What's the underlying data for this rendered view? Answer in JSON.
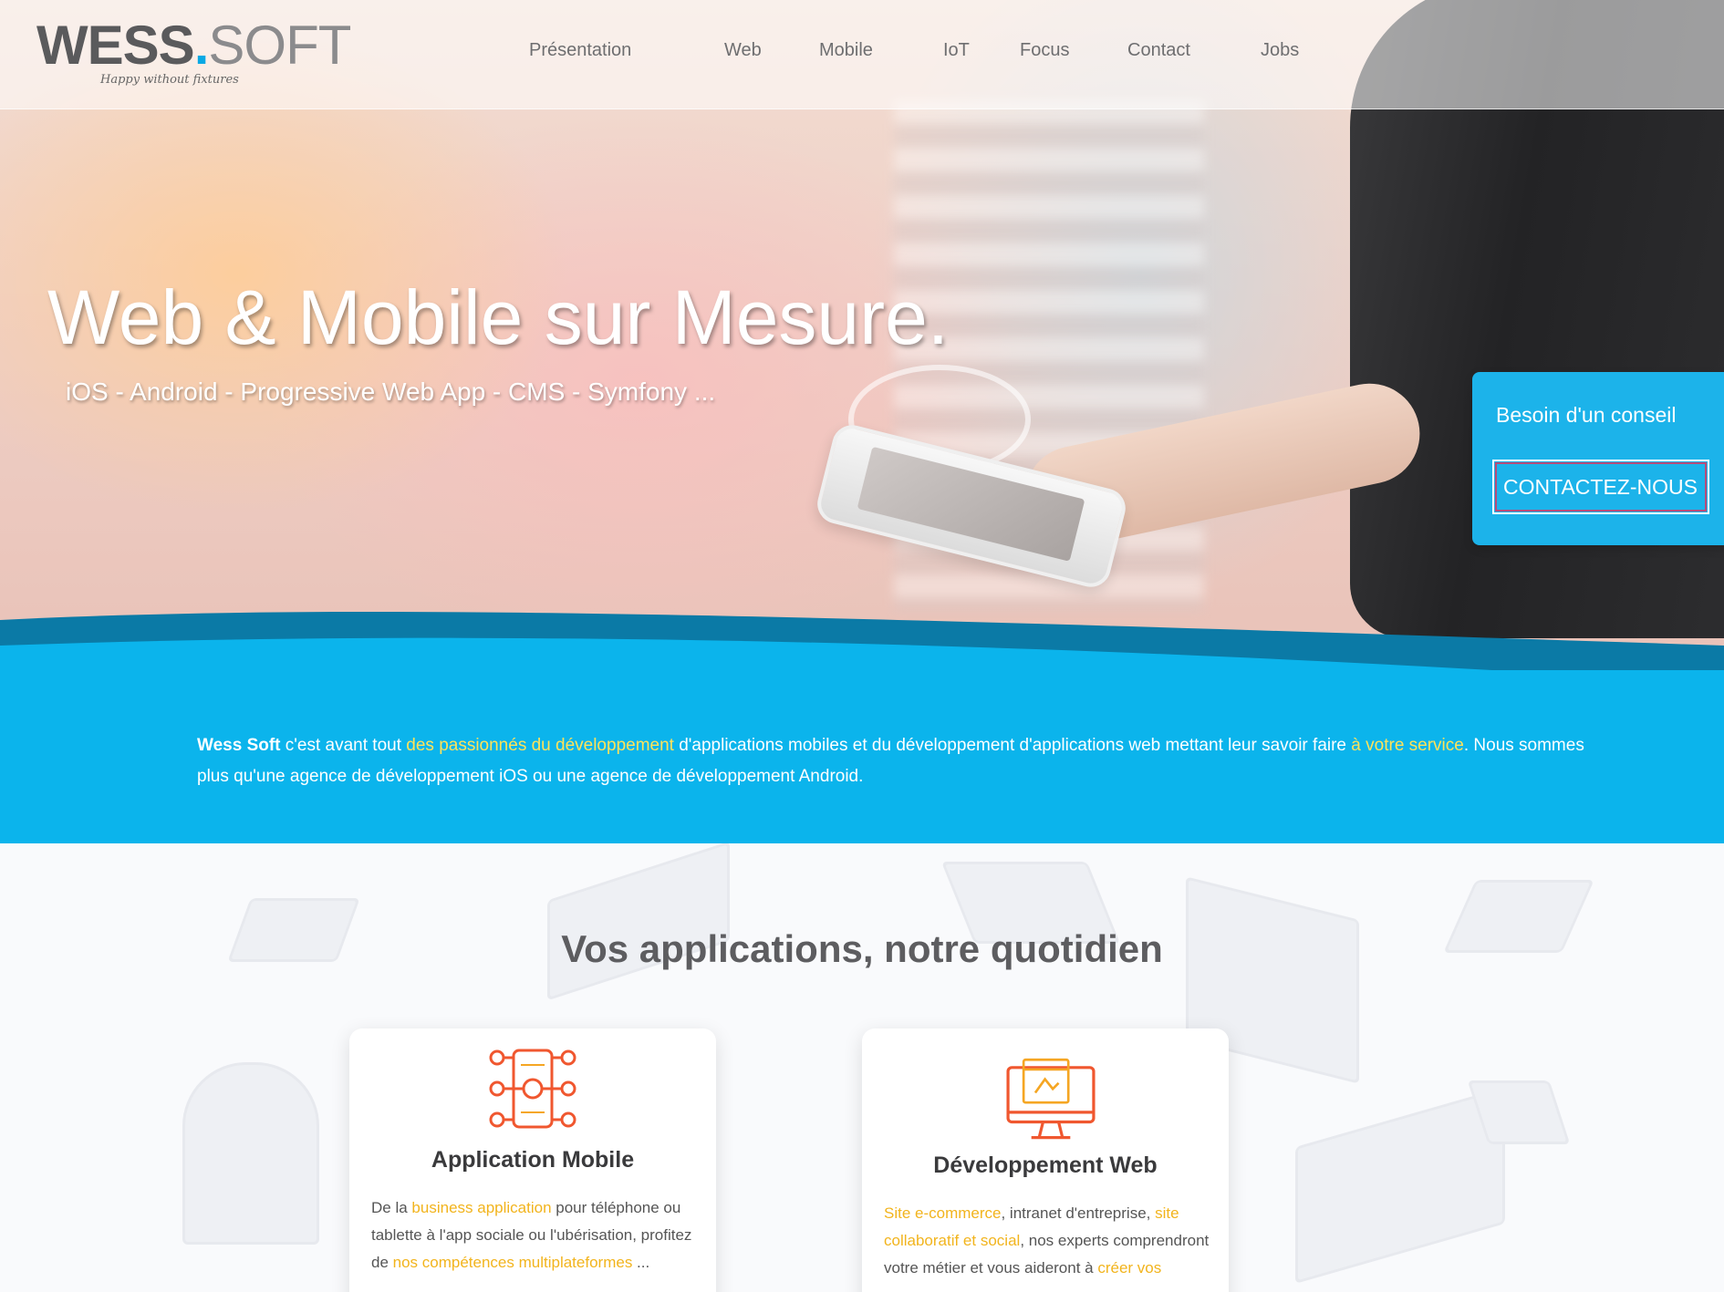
{
  "header": {
    "logo": {
      "wess": "WESS",
      "dot": ".",
      "soft": "SOFT",
      "tagline": "Happy without fixtures"
    },
    "nav": [
      "Présentation",
      "Web",
      "Mobile",
      "IoT",
      "Focus",
      "Contact",
      "Jobs"
    ]
  },
  "hero": {
    "title": "Web & Mobile sur Mesure.",
    "subtitle": "iOS - Android - Progressive Web App - CMS - Symfony ..."
  },
  "cta": {
    "label": "Besoin d'un conseil",
    "button": "CONTACTEZ-NOUS"
  },
  "intro": {
    "brand": "Wess Soft",
    "t1": " c'est avant tout ",
    "h1": "des passionnés du développement",
    "t2": " d'applications mobiles et du développement d'applications web mettant leur savoir faire ",
    "h2": "à votre service",
    "t3": ". Nous sommes plus qu'une agence de développement iOS ou une agence de développement Android."
  },
  "services": {
    "title": "Vos applications, notre quotidien",
    "cards": [
      {
        "title": "Application Mobile",
        "icon": "mobile-app-icon",
        "d1": "De la ",
        "h1": "business application",
        "d2": " pour téléphone ou tablette à l'app sociale ou l'ubérisation, profitez de ",
        "h2": "nos compétences multiplateformes",
        "d3": " ..."
      },
      {
        "title": "Développement Web",
        "icon": "web-monitor-icon",
        "h1": "Site e-commerce",
        "d1": ", intranet d'entreprise, ",
        "h2": "site collaboratif et social",
        "d2": ", nos experts comprendront votre métier et vous aideront à ",
        "h3": "créer vos"
      }
    ]
  },
  "colors": {
    "accent": "#0bb4ec",
    "highlight": "#ffe35a",
    "icon": "#f0572f"
  }
}
